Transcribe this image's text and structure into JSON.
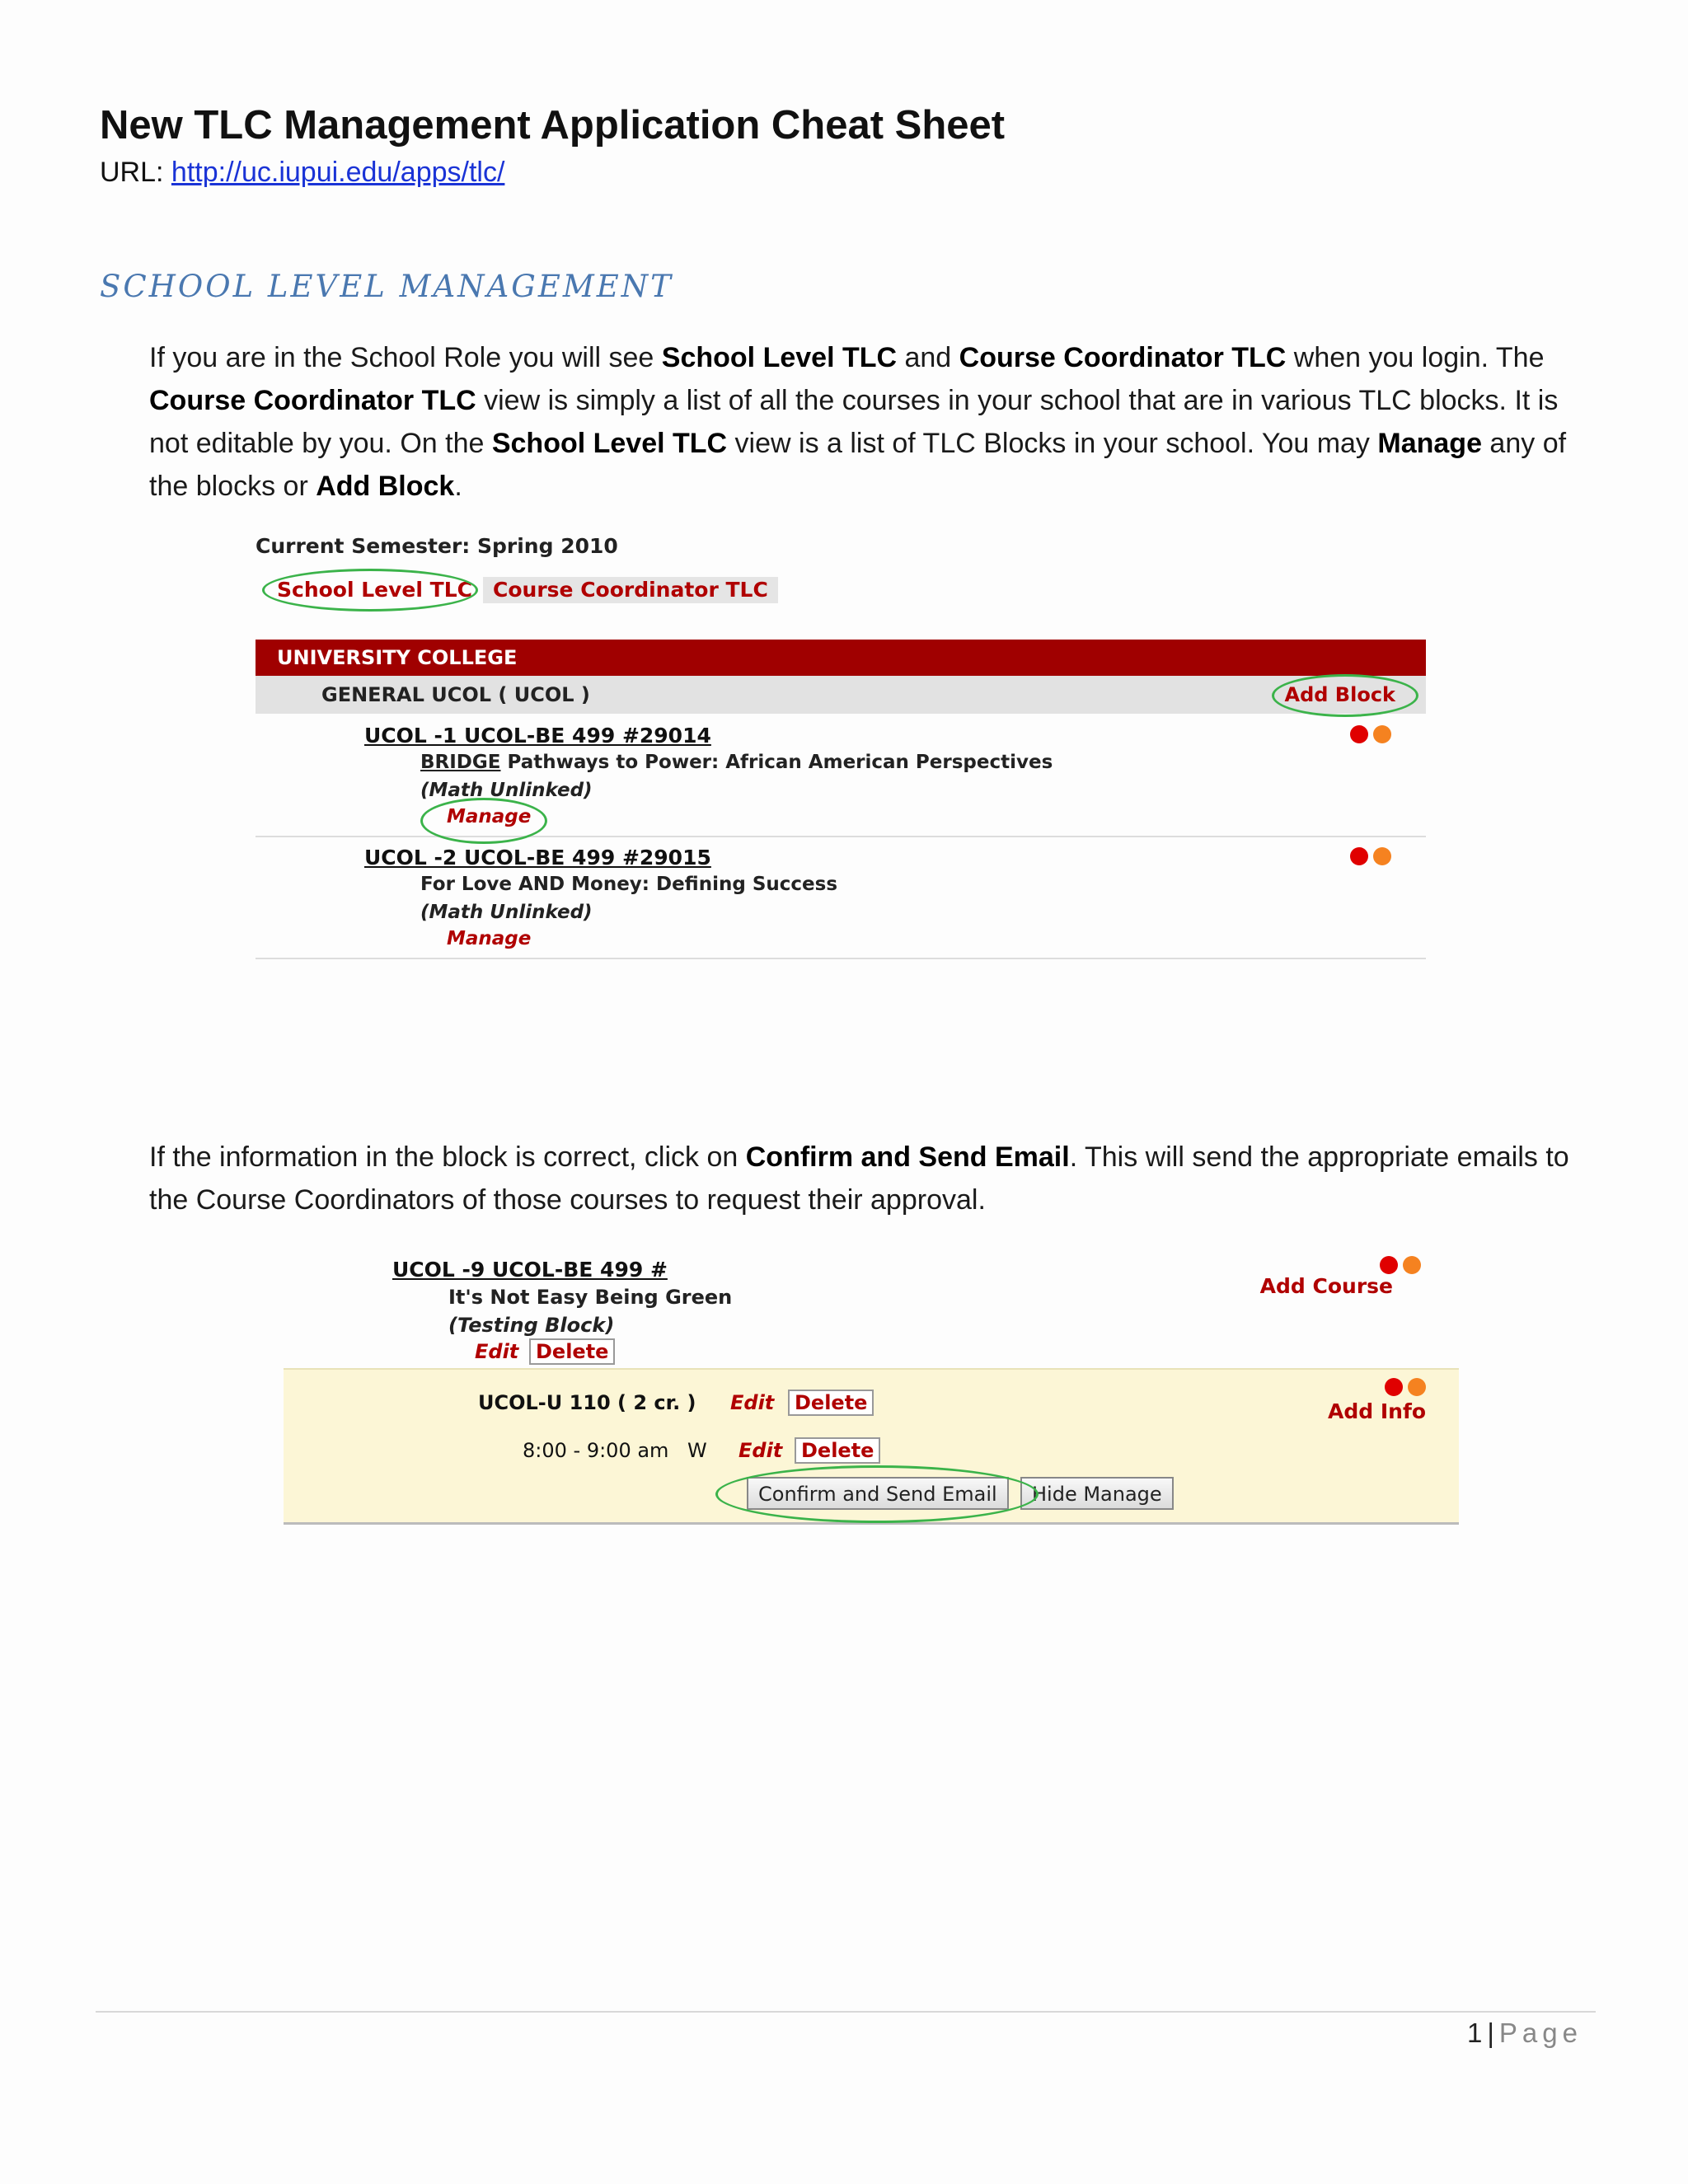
{
  "document": {
    "title": "New TLC Management Application Cheat Sheet",
    "url_label": "URL:",
    "url": "http://uc.iupui.edu/apps/tlc/",
    "section_heading": "SCHOOL LEVEL MANAGEMENT"
  },
  "para1": {
    "t1": "If you are in the School Role you will see ",
    "b1": "School Level TLC",
    "t2": " and ",
    "b2": "Course Coordinator TLC",
    "t3": " when you login.  The ",
    "b3": "Course Coordinator TLC",
    "t4": " view is simply a list of all the courses in your school that are in various TLC blocks.  It is not editable by you.  On the ",
    "b4": "School Level TLC",
    "t5": " view is a list of TLC Blocks in your school.  You may ",
    "b5": "Manage",
    "t6": " any of the blocks or ",
    "b6": "Add Block",
    "t7": "."
  },
  "screenshot1": {
    "semester": "Current Semester: Spring 2010",
    "tabs": {
      "school": "School Level TLC",
      "coordinator": "Course Coordinator TLC"
    },
    "college": "UNIVERSITY COLLEGE",
    "department": "GENERAL UCOL ( UCOL )",
    "add_block": "Add Block",
    "blocks": [
      {
        "course": "UCOL -1 UCOL-BE 499 #29014",
        "title_prefix": "BRIDGE",
        "title_rest": " Pathways to Power: African American Perspectives",
        "status": "(Math Unlinked)",
        "manage": "Manage"
      },
      {
        "course": "UCOL -2 UCOL-BE 499 #29015",
        "title_prefix": "",
        "title_rest": "For Love AND Money: Defining Success",
        "status": "(Math Unlinked)",
        "manage": "Manage"
      }
    ]
  },
  "para2": {
    "t1": "If the information in the block is correct, click on ",
    "b1": "Confirm and Send Email",
    "t2": ".  This will send the appropriate emails to the Course Coordinators of those courses to request their approval."
  },
  "screenshot2": {
    "course": "UCOL -9 UCOL-BE 499 #",
    "title": "It's Not Easy Being Green",
    "status": "(Testing Block)",
    "edit": "Edit",
    "delete": "Delete",
    "add_course": "Add Course",
    "unit": "UCOL-U 110 ( 2 cr. )",
    "add_info": "Add Info",
    "time": "8:00 - 9:00 am",
    "day": "W",
    "confirm_button": "Confirm and Send Email",
    "hide_button": "Hide Manage"
  },
  "footer": {
    "page_number": "1",
    "separator": "|",
    "page_word": "Page"
  },
  "colors": {
    "dot_red": "#e00000",
    "dot_orange": "#f58220",
    "header_red": "#a00000",
    "highlight_oval": "#3bb34a"
  }
}
